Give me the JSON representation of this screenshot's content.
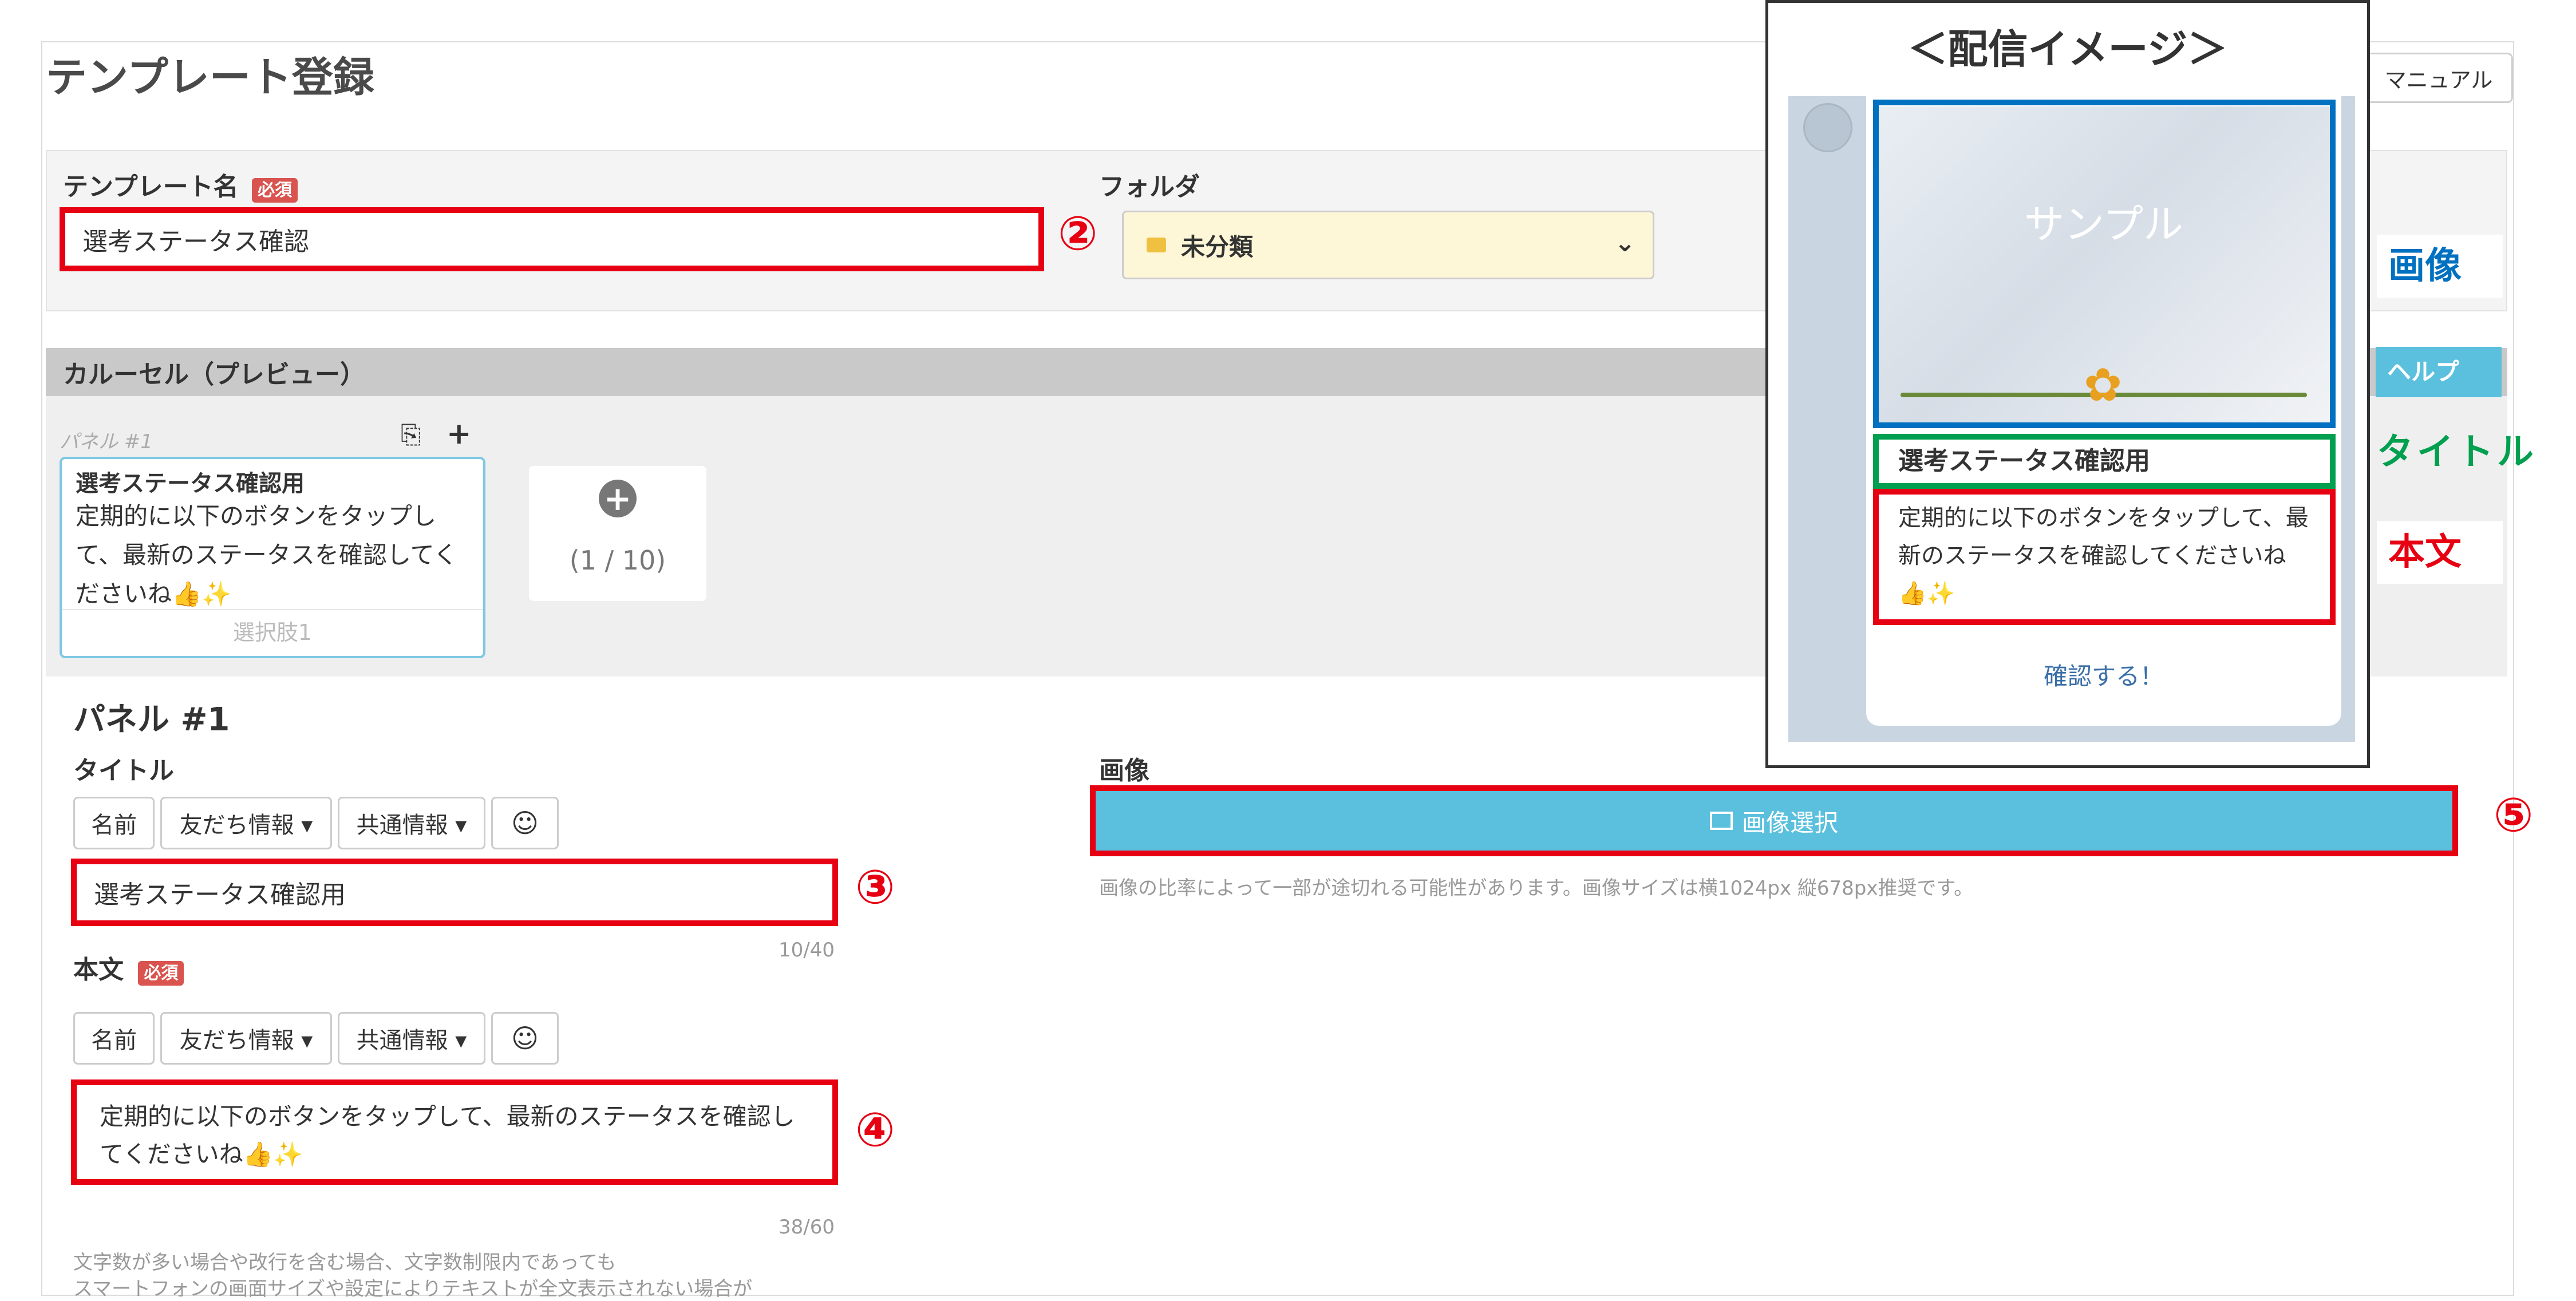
{
  "header": {
    "title": "テンプレート登録",
    "manual_button": "マニュアル"
  },
  "template_form": {
    "name_label": "テンプレート名",
    "required_badge": "必須",
    "name_value": "選考ステータス確認",
    "folder_label": "フォルダ",
    "folder_value": "未分類"
  },
  "carousel": {
    "header": "カルーセル（プレビュー）",
    "panel_label": "パネル #1",
    "card_title": "選考ステータス確認用",
    "card_body": "定期的に以下のボタンをタップして、最新のステータスを確認してくださいね👍✨",
    "card_choice": "選択肢1",
    "count": "(1 / 10)",
    "help_button": "ヘルプ"
  },
  "panel_editor": {
    "heading": "パネル #1",
    "title_label": "タイトル",
    "toolbar": {
      "name": "名前",
      "friend_info": "友だち情報 ▾",
      "common_info": "共通情報 ▾"
    },
    "title_value": "選考ステータス確認用",
    "title_count": "10/40",
    "body_label": "本文",
    "body_value": "定期的に以下のボタンをタップして、最新のステータスを確認してくださいね👍✨",
    "body_count": "38/60",
    "note_line1": "文字数が多い場合や改行を含む場合、文字数制限内であっても",
    "note_line2": "スマートフォンの画面サイズや設定によりテキストが全文表示されない場合が",
    "image_label": "画像",
    "image_button": "画像選択",
    "image_note": "画像の比率によって一部が途切れる可能性があります。画像サイズは横1024px 縦678px推奨です。"
  },
  "annotations": {
    "n2": "②",
    "n3": "③",
    "n4": "④",
    "n5": "⑤"
  },
  "preview": {
    "heading": "＜配信イメージ＞",
    "sample_text": "サンプル",
    "title": "選考ステータス確認用",
    "body": "定期的に以下のボタンをタップして、最新のステータスを確認してくださいね👍✨",
    "action": "確認する！",
    "tag_image": "画像",
    "tag_title": "タイトル",
    "tag_body": "本文"
  },
  "colors": {
    "accent_red": "#e60012",
    "info_blue": "#5bc0de",
    "tag_blue": "#0070c0",
    "tag_green": "#00a050"
  }
}
